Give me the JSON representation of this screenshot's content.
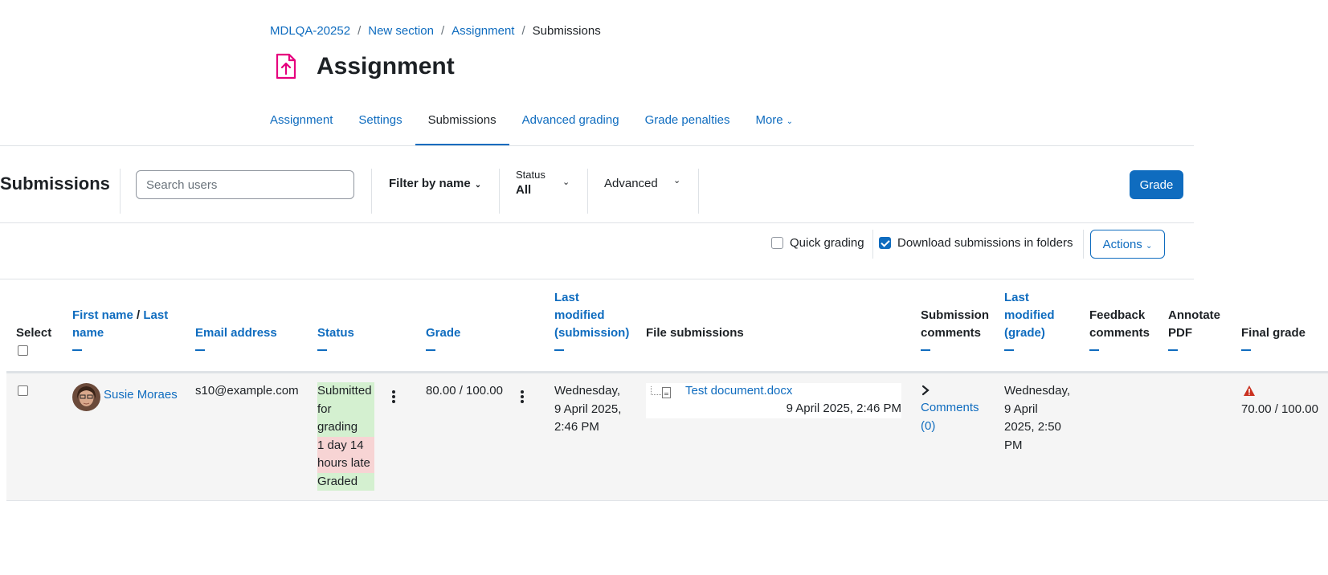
{
  "breadcrumb": {
    "items": [
      "MDLQA-20252",
      "New section",
      "Assignment"
    ],
    "current": "Submissions",
    "separator": "/"
  },
  "page": {
    "title": "Assignment"
  },
  "tabs": [
    {
      "label": "Assignment"
    },
    {
      "label": "Settings"
    },
    {
      "label": "Submissions"
    },
    {
      "label": "Advanced grading"
    },
    {
      "label": "Grade penalties"
    },
    {
      "label": "More"
    }
  ],
  "toolbar": {
    "title": "Submissions",
    "search_placeholder": "Search users",
    "filter_by_name": "Filter by name",
    "status_label": "Status",
    "status_value": "All",
    "advanced": "Advanced",
    "grade_button": "Grade"
  },
  "options": {
    "quick_grading": "Quick grading",
    "quick_grading_checked": false,
    "download_in_folders": "Download submissions in folders",
    "download_in_folders_checked": true,
    "actions": "Actions"
  },
  "table": {
    "headers": {
      "select": "Select",
      "first_name": "First name",
      "last_name_line1": "Last",
      "last_name_line2": "name",
      "email": "Email address",
      "status": "Status",
      "grade": "Grade",
      "last_modified_sub_1": "Last",
      "last_modified_sub_2": "modified",
      "last_modified_sub_3": "(submission)",
      "file_submissions": "File submissions",
      "submission_comments_1": "Submission",
      "submission_comments_2": "comments",
      "last_modified_grade_1": "Last",
      "last_modified_grade_2": "modified",
      "last_modified_grade_3": "(grade)",
      "feedback_comments_1": "Feedback",
      "feedback_comments_2": "comments",
      "annotate_pdf_1": "Annotate",
      "annotate_pdf_2": "PDF",
      "final_grade": "Final grade"
    },
    "rows": [
      {
        "name": "Susie Moraes",
        "email": "s10@example.com",
        "status_lines": [
          "Submitted",
          "for",
          "grading"
        ],
        "late_lines": [
          "1 day 14",
          "hours late"
        ],
        "graded": "Graded",
        "grade": "80.00 / 100.00",
        "modified_submission": [
          "Wednesday,",
          "9 April 2025,",
          "2:46 PM"
        ],
        "file_name": "Test document.docx",
        "file_date": "9 April 2025, 2:46 PM",
        "comments": [
          "Comments",
          "(0)"
        ],
        "modified_grade": [
          "Wednesday,",
          "9 April",
          "2025, 2:50",
          "PM"
        ],
        "final_grade": "70.00 / 100.00"
      }
    ]
  },
  "colors": {
    "link": "#0f6cbf",
    "status_submitted_bg": "#d4f0d0",
    "status_late_bg": "#f7d4d4",
    "warning": "#ca3120",
    "activity_icon": "#e6007e"
  }
}
